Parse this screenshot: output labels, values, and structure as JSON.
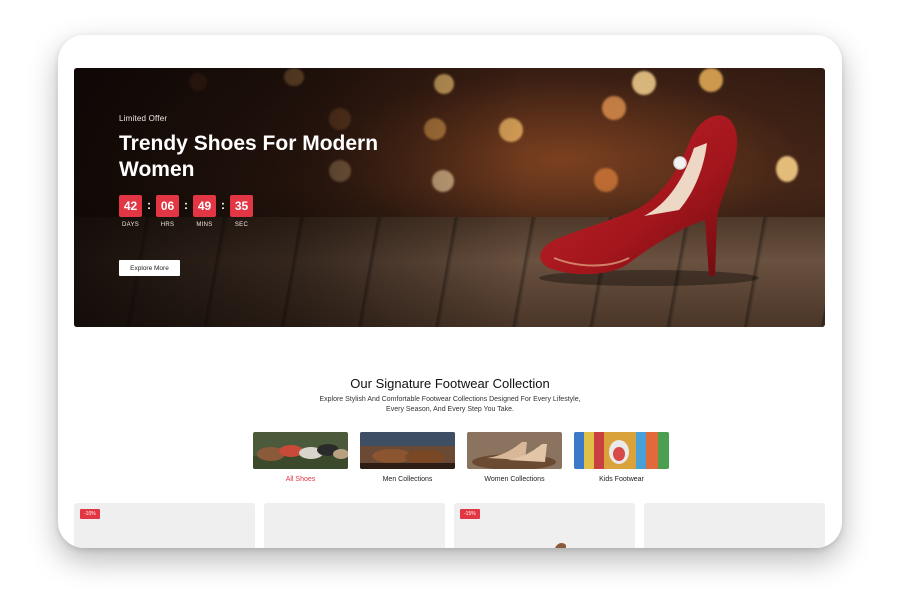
{
  "hero": {
    "eyebrow": "Limited Offer",
    "title": "Trendy Shoes For Modern Women",
    "countdown": [
      {
        "value": "42",
        "label": "DAYS"
      },
      {
        "value": "06",
        "label": "HRS"
      },
      {
        "value": "49",
        "label": "MINS"
      },
      {
        "value": "35",
        "label": "SEC"
      }
    ],
    "cta": "Explore More"
  },
  "collection": {
    "title": "Our Signature Footwear Collection",
    "subtitle": "Explore Stylish And Comfortable Footwear Collections Designed For Every Lifestyle, Every Season, And Every Step You Take.",
    "categories": [
      {
        "label": "All Shoes",
        "active": true
      },
      {
        "label": "Men Collections",
        "active": false
      },
      {
        "label": "Women Collections",
        "active": false
      },
      {
        "label": "Kids Footwear",
        "active": false
      }
    ]
  },
  "products": [
    {
      "badge": "-10%"
    },
    {
      "badge": ""
    },
    {
      "badge": "-15%"
    },
    {
      "badge": ""
    }
  ],
  "colors": {
    "accent": "#e23644"
  }
}
